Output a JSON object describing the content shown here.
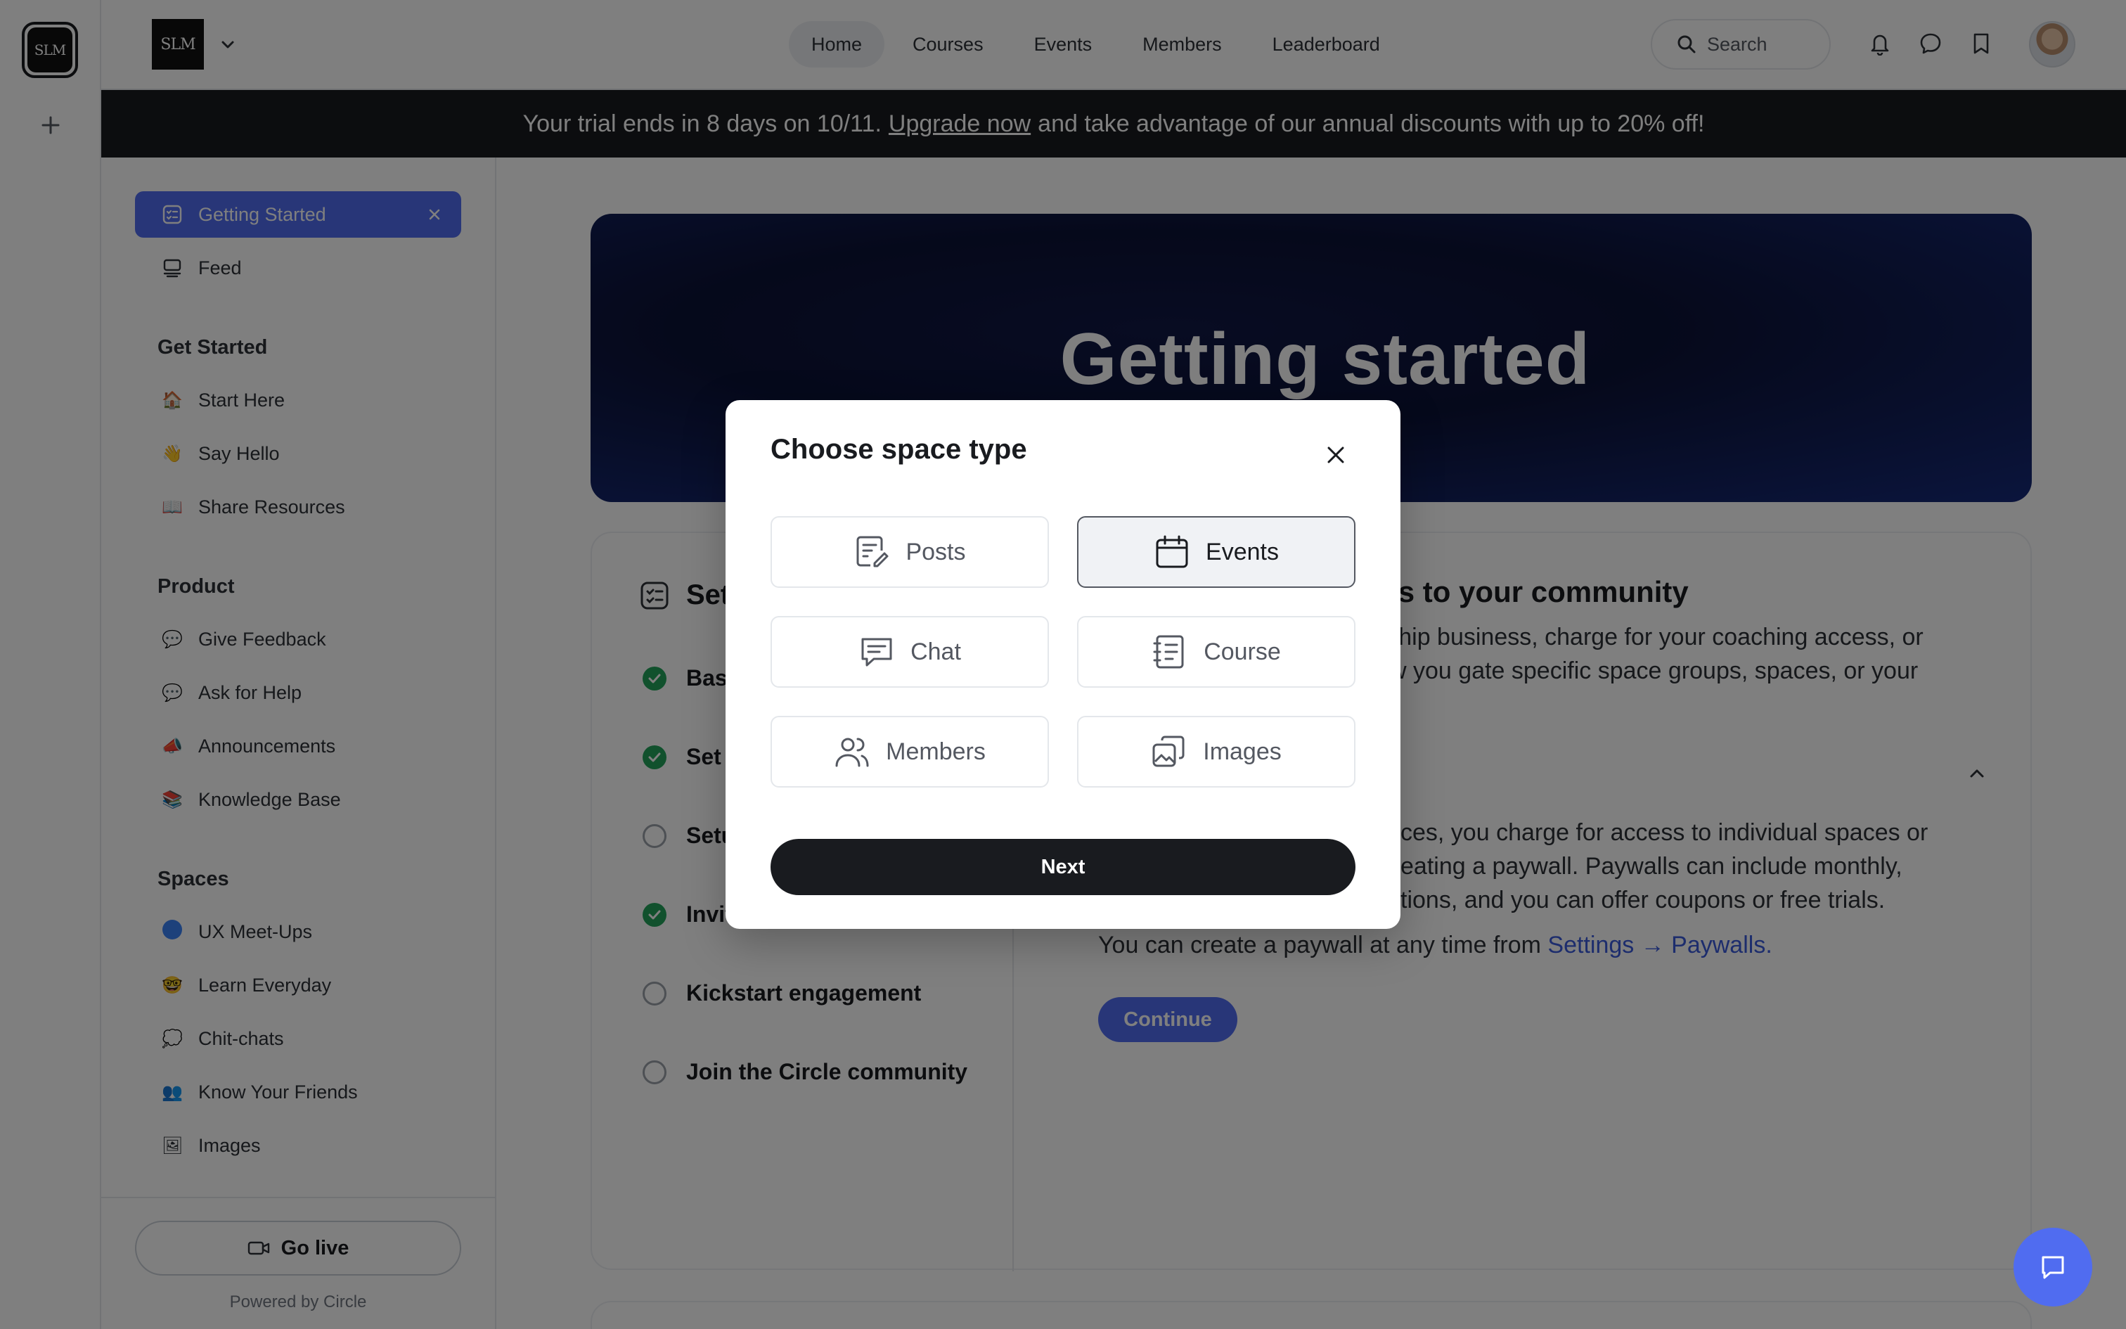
{
  "rail": {
    "logo_text": "SLM"
  },
  "header": {
    "brand_text": "SLM",
    "nav": [
      {
        "label": "Home",
        "active": true
      },
      {
        "label": "Courses",
        "active": false
      },
      {
        "label": "Events",
        "active": false
      },
      {
        "label": "Members",
        "active": false
      },
      {
        "label": "Leaderboard",
        "active": false
      }
    ],
    "search_placeholder": "Search"
  },
  "banner": {
    "before": "Your trial ends in 8 days on 10/11.",
    "link": "Upgrade now",
    "after": "and take advantage of our annual discounts with up to 20% off!"
  },
  "sidebar": {
    "top_items": [
      {
        "label": "Getting Started",
        "active": true,
        "icon": "checklist-icon"
      },
      {
        "label": "Feed",
        "active": false,
        "icon": "feed-icon"
      }
    ],
    "sections": [
      {
        "title": "Get Started",
        "items": [
          {
            "emoji": "🏠",
            "label": "Start Here"
          },
          {
            "emoji": "👋",
            "label": "Say Hello"
          },
          {
            "emoji": "📖",
            "label": "Share Resources"
          }
        ]
      },
      {
        "title": "Product",
        "items": [
          {
            "emoji": "💬",
            "label": "Give Feedback"
          },
          {
            "emoji": "💬",
            "label": "Ask for Help"
          },
          {
            "emoji": "📣",
            "label": "Announcements"
          },
          {
            "emoji": "📚",
            "label": "Knowledge Base"
          }
        ]
      },
      {
        "title": "Spaces",
        "items": [
          {
            "emoji": "",
            "label": "UX Meet-Ups"
          },
          {
            "emoji": "🤓",
            "label": "Learn Everyday"
          },
          {
            "emoji": "💭",
            "label": "Chit-chats"
          },
          {
            "emoji": "👥",
            "label": "Know Your Friends"
          },
          {
            "emoji": "🖼",
            "label": "Images"
          }
        ]
      }
    ],
    "go_live_label": "Go live",
    "powered_by": "Powered by Circle"
  },
  "hero": {
    "title": "Getting started"
  },
  "steps": {
    "title": "Set",
    "items": [
      {
        "label": "Bas",
        "done": true
      },
      {
        "label": "Set",
        "done": true
      },
      {
        "label": "Setu",
        "done": false
      },
      {
        "label": "Invit",
        "done": true
      },
      {
        "label": "Kickstart engagement",
        "done": false
      },
      {
        "label": "Join the Circle community",
        "done": false
      }
    ]
  },
  "detail": {
    "title": "ess to your community",
    "para1_line1": "ership business, charge for your coaching access, or",
    "para1_line2": "llow you gate specific space groups, spaces, or your",
    "para2_line1": "ces, you charge for access to individual spaces or",
    "para2_line2": "eating a paywall. Paywalls can include monthly,",
    "para2_line3": "tions, and you can offer coupons or free trials.",
    "para3_text": "You can create a paywall at any time from ",
    "para3_link": "Settings → Paywalls.",
    "continue_label": "Continue"
  },
  "modal": {
    "title": "Choose space type",
    "options": [
      {
        "label": "Posts",
        "icon": "posts-icon",
        "selected": false
      },
      {
        "label": "Events",
        "icon": "calendar-icon",
        "selected": true
      },
      {
        "label": "Chat",
        "icon": "chat-icon",
        "selected": false
      },
      {
        "label": "Course",
        "icon": "course-icon",
        "selected": false
      },
      {
        "label": "Members",
        "icon": "members-icon",
        "selected": false
      },
      {
        "label": "Images",
        "icon": "images-icon",
        "selected": false
      }
    ],
    "next_label": "Next"
  },
  "colors": {
    "accent": "#506cf0",
    "banner_bg": "#191b1f",
    "success": "#22a35a",
    "link": "#3b5bdb"
  }
}
